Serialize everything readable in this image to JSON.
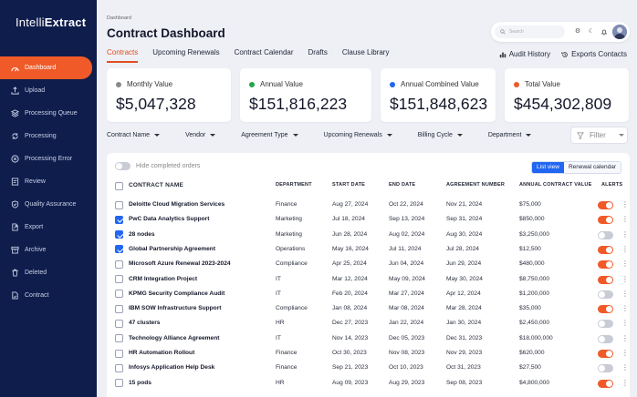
{
  "app": {
    "logo_light": "Intelli",
    "logo_bold": "Extract"
  },
  "sidebar": {
    "items": [
      {
        "label": "Dashboard",
        "icon": "dashboard-icon",
        "active": true
      },
      {
        "label": "Upload",
        "icon": "upload-icon"
      },
      {
        "label": "Processing Queue",
        "icon": "queue-icon"
      },
      {
        "label": "Processing",
        "icon": "processing-icon"
      },
      {
        "label": "Processing Error",
        "icon": "error-icon"
      },
      {
        "label": "Review",
        "icon": "review-icon"
      },
      {
        "label": "Quality Assurance",
        "icon": "shield-icon"
      },
      {
        "label": "Export",
        "icon": "export-icon"
      },
      {
        "label": "Archive",
        "icon": "archive-icon"
      },
      {
        "label": "Deleted",
        "icon": "trash-icon"
      },
      {
        "label": "Contract",
        "icon": "contract-icon"
      }
    ]
  },
  "header": {
    "breadcrumb": "Dashboard",
    "title": "Contract Dashboard",
    "search_placeholder": "Search"
  },
  "tabs": [
    "Contracts",
    "Upcoming Renewals",
    "Contract Calendar",
    "Drafts",
    "Clause Library"
  ],
  "tab_actions": {
    "audit": "Audit History",
    "export": "Exports Contacts"
  },
  "cards": [
    {
      "label": "Monthly Value",
      "value": "$5,047,328",
      "color": "#8a8a8a"
    },
    {
      "label": "Annual Value",
      "value": "$151,816,223",
      "color": "#22a64a"
    },
    {
      "label": "Annual Combined Value",
      "value": "$151,848,623",
      "color": "#2166f2"
    },
    {
      "label": "Total Value",
      "value": "$454,302,809",
      "color": "#f05a28"
    }
  ],
  "filters": [
    "Contract Name",
    "Vendor",
    "Agreement Type",
    "Upcoming Renewals",
    "Billing Cycle",
    "Department"
  ],
  "filter_button": "Filter",
  "table": {
    "hide_completed": "Hide completed orders",
    "view_list": "List view",
    "view_calendar": "Renewal calendar",
    "columns": [
      "CONTRACT NAME",
      "DEPARTMENT",
      "START DATE",
      "END DATE",
      "AGREEMENT NUMBER",
      "ANNUAL CONTRACT VALUE",
      "ALERTS"
    ],
    "rows": [
      {
        "name": "Deloitte Cloud Migration Services",
        "dept": "Finance",
        "start": "Aug 27, 2024",
        "end": "Oct 22, 2024",
        "agreement": "Nov 21, 2024",
        "value": "$75,000",
        "checked": false,
        "alert": true
      },
      {
        "name": "PwC Data Analytics Support",
        "dept": "Marketing",
        "start": "Jul 18, 2024",
        "end": "Sep 13, 2024",
        "agreement": "Sep 31, 2024",
        "value": "$850,000",
        "checked": true,
        "alert": true
      },
      {
        "name": "28 nodes",
        "dept": "Marketing",
        "start": "Jun 28, 2024",
        "end": "Aug 02, 2024",
        "agreement": "Aug 30, 2024",
        "value": "$3,250,000",
        "checked": true,
        "alert": false
      },
      {
        "name": "Global Partnership Agreement",
        "dept": "Operations",
        "start": "May 16, 2024",
        "end": "Jul 11, 2024",
        "agreement": "Jul 28, 2024",
        "value": "$12,500",
        "checked": true,
        "alert": true
      },
      {
        "name": "Microsoft Azure Renewal 2023-2024",
        "dept": "Compliance",
        "start": "Apr 25, 2024",
        "end": "Jun 04, 2024",
        "agreement": "Jun 29, 2024",
        "value": "$480,000",
        "checked": false,
        "alert": true
      },
      {
        "name": "CRM Integration Project",
        "dept": "IT",
        "start": "Mar 12, 2024",
        "end": "May 09, 2024",
        "agreement": "May 30, 2024",
        "value": "$8,750,000",
        "checked": false,
        "alert": true
      },
      {
        "name": "KPMG Security Compliance Audit",
        "dept": "IT",
        "start": "Feb 20, 2024",
        "end": "Mar 27, 2024",
        "agreement": "Apr 12, 2024",
        "value": "$1,200,000",
        "checked": false,
        "alert": false
      },
      {
        "name": "IBM SOW Infrastructure Support",
        "dept": "Compliance",
        "start": "Jan 08, 2024",
        "end": "Mar 08, 2024",
        "agreement": "Mar 28, 2024",
        "value": "$35,000",
        "checked": false,
        "alert": true
      },
      {
        "name": "47 clusters",
        "dept": "HR",
        "start": "Dec 27, 2023",
        "end": "Jan 22, 2024",
        "agreement": "Jan 30, 2024",
        "value": "$2,450,000",
        "checked": false,
        "alert": false
      },
      {
        "name": "Technology Alliance Agreement",
        "dept": "IT",
        "start": "Nov 14, 2023",
        "end": "Dec 05, 2023",
        "agreement": "Dec 31, 2023",
        "value": "$18,000,000",
        "checked": false,
        "alert": false
      },
      {
        "name": "HR Automation Rollout",
        "dept": "Finance",
        "start": "Oct 30, 2023",
        "end": "Nov 08, 2023",
        "agreement": "Nov 29, 2023",
        "value": "$620,000",
        "checked": false,
        "alert": true
      },
      {
        "name": "Infosys Application Help Desk",
        "dept": "Finance",
        "start": "Sep 21, 2023",
        "end": "Oct 10, 2023",
        "agreement": "Oct 31, 2023",
        "value": "$27,500",
        "checked": false,
        "alert": false
      },
      {
        "name": "15 pods",
        "dept": "HR",
        "start": "Aug 09, 2023",
        "end": "Aug 29, 2023",
        "agreement": "Sep 08, 2023",
        "value": "$4,800,000",
        "checked": false,
        "alert": true
      }
    ]
  }
}
